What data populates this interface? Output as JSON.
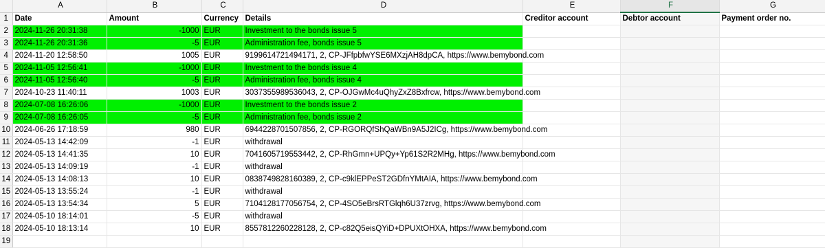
{
  "columns": [
    "A",
    "B",
    "C",
    "D",
    "E",
    "F",
    "G"
  ],
  "header_row": {
    "num": "1",
    "date": "Date",
    "amount": "Amount",
    "currency": "Currency",
    "details": "Details",
    "creditor": "Creditor account",
    "debtor": "Debtor account",
    "payment_order": "Payment order no."
  },
  "rows": [
    {
      "num": "2",
      "date": "2024-11-26 20:31:38",
      "amount": "-1000",
      "currency": "EUR",
      "details": "Investment to the bonds issue 5",
      "highlight": true
    },
    {
      "num": "3",
      "date": "2024-11-26 20:31:36",
      "amount": "-5",
      "currency": "EUR",
      "details": "Administration fee, bonds issue 5",
      "highlight": true
    },
    {
      "num": "4",
      "date": "2024-11-20 12:58:50",
      "amount": "1005",
      "currency": "EUR",
      "details": "9199614721494171, 2, CP-JFfpbfwYSE6MXzjAH8dpCA, https://www.bemybond.com",
      "highlight": false
    },
    {
      "num": "5",
      "date": "2024-11-05 12:56:41",
      "amount": "-1000",
      "currency": "EUR",
      "details": "Investment to the bonds issue 4",
      "highlight": true
    },
    {
      "num": "6",
      "date": "2024-11-05 12:56:40",
      "amount": "-5",
      "currency": "EUR",
      "details": "Administration fee, bonds issue 4",
      "highlight": true
    },
    {
      "num": "7",
      "date": "2024-10-23 11:40:11",
      "amount": "1003",
      "currency": "EUR",
      "details": "3037355989536043, 2, CP-OJGwMc4uQhyZxZ8Bxfrcw, https://www.bemybond.com",
      "highlight": false
    },
    {
      "num": "8",
      "date": "2024-07-08 16:26:06",
      "amount": "-1000",
      "currency": "EUR",
      "details": "Investment to the bonds issue 2",
      "highlight": true
    },
    {
      "num": "9",
      "date": "2024-07-08 16:26:05",
      "amount": "-5",
      "currency": "EUR",
      "details": "Administration fee, bonds issue 2",
      "highlight": true
    },
    {
      "num": "10",
      "date": "2024-06-26 17:18:59",
      "amount": "980",
      "currency": "EUR",
      "details": "6944228701507856, 2, CP-RGORQfShQaWBn9A5J2ICg, https://www.bemybond.com",
      "highlight": false
    },
    {
      "num": "11",
      "date": "2024-05-13 14:42:09",
      "amount": "-1",
      "currency": "EUR",
      "details": "withdrawal",
      "highlight": false
    },
    {
      "num": "12",
      "date": "2024-05-13 14:41:35",
      "amount": "10",
      "currency": "EUR",
      "details": "7041605719553442, 2, CP-RhGmn+UPQy+Yp61S2R2MHg, https://www.bemybond.com",
      "highlight": false
    },
    {
      "num": "13",
      "date": "2024-05-13 14:09:19",
      "amount": "-1",
      "currency": "EUR",
      "details": "withdrawal",
      "highlight": false
    },
    {
      "num": "14",
      "date": "2024-05-13 14:08:13",
      "amount": "10",
      "currency": "EUR",
      "details": "0838749828160389, 2, CP-c9klEPPeST2GDfnYMtAIA, https://www.bemybond.com",
      "highlight": false
    },
    {
      "num": "15",
      "date": "2024-05-13 13:55:24",
      "amount": "-1",
      "currency": "EUR",
      "details": "withdrawal",
      "highlight": false
    },
    {
      "num": "16",
      "date": "2024-05-13 13:54:34",
      "amount": "5",
      "currency": "EUR",
      "details": "7104128177056754, 2, CP-4SO5eBrsRTGlqh6U37zrvg, https://www.bemybond.com",
      "highlight": false
    },
    {
      "num": "17",
      "date": "2024-05-10 18:14:01",
      "amount": "-5",
      "currency": "EUR",
      "details": "withdrawal",
      "highlight": false
    },
    {
      "num": "18",
      "date": "2024-05-10 18:13:14",
      "amount": "10",
      "currency": "EUR",
      "details": "8557812260228128, 2, CP-c82Q5eisQYiD+DPUXtOHXA, https://www.bemybond.com",
      "highlight": false
    }
  ],
  "partial_row_num": "19",
  "highlight_color": "#00f000"
}
